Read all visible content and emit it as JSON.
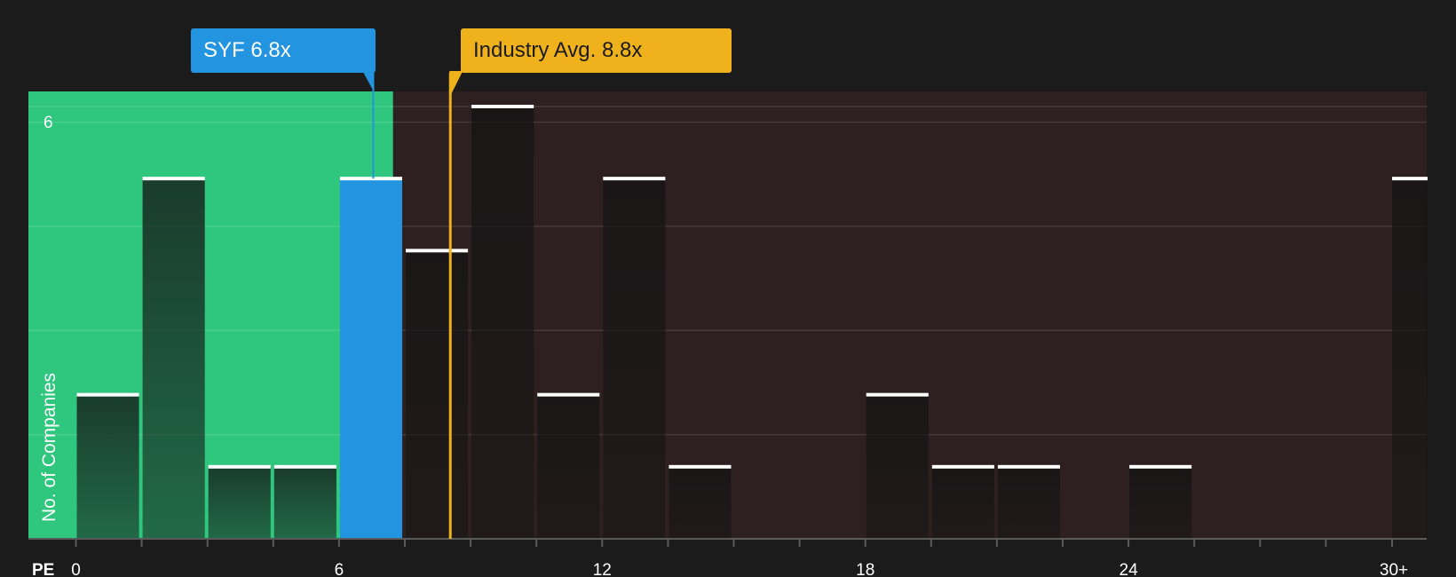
{
  "chart_data": {
    "type": "bar",
    "xlabel": "PE",
    "ylabel": "No. of Companies",
    "x_tick_labels": [
      "0",
      "6",
      "12",
      "18",
      "24",
      "30+"
    ],
    "x_tick_values": [
      0,
      6,
      12,
      18,
      24,
      30
    ],
    "y_tick_labels": [
      "6"
    ],
    "ylim": [
      0,
      6
    ],
    "bin_width": 1.5,
    "bins": [
      {
        "x0": 0.0,
        "count": 2
      },
      {
        "x0": 1.5,
        "count": 5
      },
      {
        "x0": 3.0,
        "count": 1
      },
      {
        "x0": 4.5,
        "count": 1
      },
      {
        "x0": 6.0,
        "count": 5,
        "highlight": true
      },
      {
        "x0": 7.5,
        "count": 4
      },
      {
        "x0": 9.0,
        "count": 6
      },
      {
        "x0": 10.5,
        "count": 2
      },
      {
        "x0": 12.0,
        "count": 5
      },
      {
        "x0": 13.5,
        "count": 1
      },
      {
        "x0": 18.0,
        "count": 2
      },
      {
        "x0": 19.5,
        "count": 1
      },
      {
        "x0": 21.0,
        "count": 1
      },
      {
        "x0": 24.0,
        "count": 1
      },
      {
        "x0": 30.0,
        "count": 5
      }
    ],
    "company": {
      "ticker": "SYF",
      "pe": 6.8,
      "label": "SYF 6.8x"
    },
    "industry": {
      "pe": 8.8,
      "label": "Industry Avg. 8.8x"
    },
    "colors": {
      "background": "#1b1b1b",
      "undervalued_zone": "#2fc77e",
      "overvalued_zone": "#2e1f20",
      "company": "#2394e0",
      "industry": "#f0b21c",
      "bar_cap": "#ffffff"
    },
    "grid": true
  }
}
